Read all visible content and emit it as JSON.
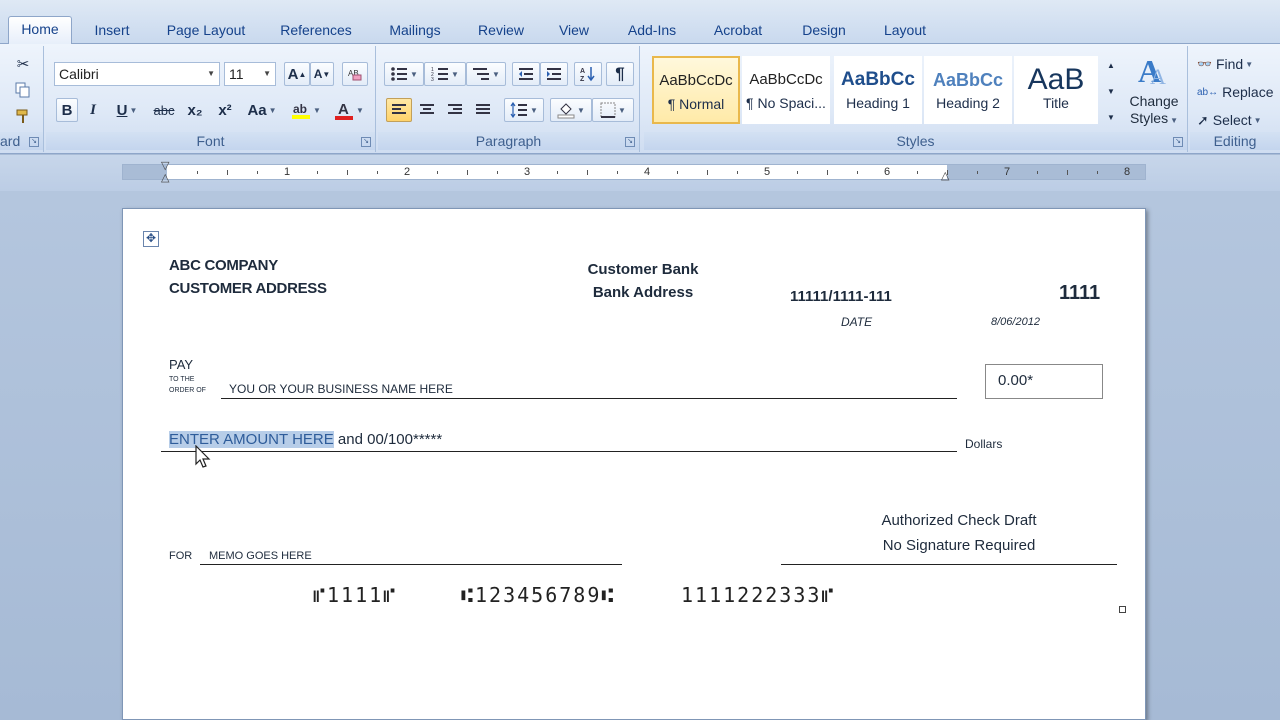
{
  "tabs": [
    {
      "label": "Home",
      "active": true
    },
    {
      "label": "Insert"
    },
    {
      "label": "Page Layout"
    },
    {
      "label": "References"
    },
    {
      "label": "Mailings"
    },
    {
      "label": "Review"
    },
    {
      "label": "View"
    },
    {
      "label": "Add-Ins"
    },
    {
      "label": "Acrobat"
    },
    {
      "label": "Design"
    },
    {
      "label": "Layout"
    }
  ],
  "ribbon": {
    "clipboard": {
      "label": "ard",
      "cut_icon": "scissors-icon",
      "copy_icon": "copy-icon",
      "format_painter_icon": "paintbrush-icon"
    },
    "font": {
      "label": "Font",
      "family": "Calibri",
      "size": "11",
      "grow": "A",
      "shrink": "A",
      "bold": "B",
      "italic": "I",
      "underline": "U",
      "strike": "abc",
      "subscript": "x₂",
      "superscript": "x²",
      "change_case": "Aa",
      "font_color": "A"
    },
    "paragraph": {
      "label": "Paragraph",
      "pilcrow": "¶"
    },
    "styles": {
      "label": "Styles",
      "items": [
        {
          "sample": "AaBbCcDc",
          "name": "¶ Normal",
          "selected": true
        },
        {
          "sample": "AaBbCcDc",
          "name": "¶ No Spaci..."
        },
        {
          "sample": "AaBbCc",
          "name": "Heading 1"
        },
        {
          "sample": "AaBbCc",
          "name": "Heading 2"
        },
        {
          "sample": "AaB",
          "name": "Title"
        }
      ],
      "change_styles_line1": "Change",
      "change_styles_line2": "Styles"
    },
    "editing": {
      "label": "Editing",
      "find": "Find",
      "replace": "Replace",
      "select": "Select"
    }
  },
  "ruler": {
    "numbers": [
      "1",
      "2",
      "3",
      "4",
      "5",
      "6",
      "7",
      "8"
    ]
  },
  "check": {
    "company_name": "ABC COMPANY",
    "company_address": "CUSTOMER ADDRESS",
    "bank_name": "Customer Bank",
    "bank_address": "Bank Address",
    "routing_fraction": "11111/1111-111",
    "check_number": "1111",
    "date_label": "DATE",
    "date_value": "8/06/2012",
    "pay_label": "PAY",
    "to_the_label": "TO THE",
    "order_of_label": "ORDER OF",
    "payee": "YOU OR YOUR BUSINESS NAME HERE",
    "amount_numeric": "0.00*",
    "amount_words_selected": "ENTER AMOUNT HERE",
    "amount_words_rest": " and 00/100*****",
    "dollars_label": "Dollars",
    "for_label": "FOR",
    "memo": "MEMO GOES HERE",
    "signature_line1": "Authorized Check Draft",
    "signature_line2": "No Signature Required",
    "micr_check": "⑈1111⑈",
    "micr_routing": "⑆123456789⑆",
    "micr_account": "1111222333⑈"
  }
}
